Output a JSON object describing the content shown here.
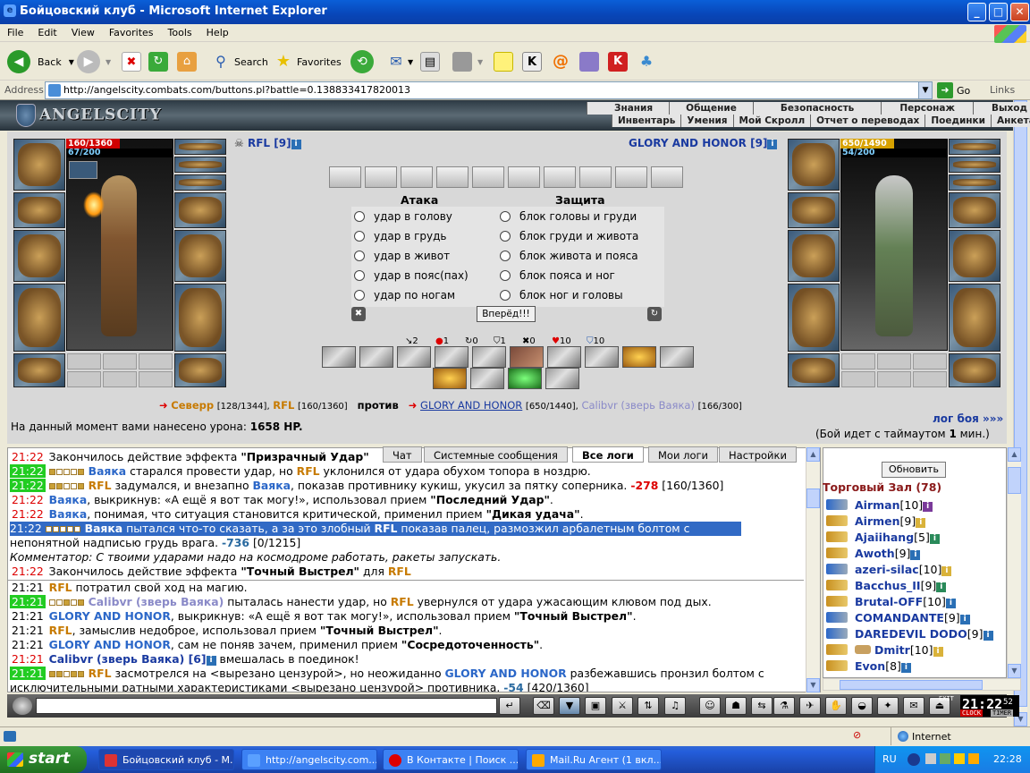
{
  "window": {
    "title": "Бойцовский клуб - Microsoft Internet Explorer",
    "min": "_",
    "max": "□",
    "close": "✕"
  },
  "menu": [
    "File",
    "Edit",
    "View",
    "Favorites",
    "Tools",
    "Help"
  ],
  "toolbar": {
    "back": "Back",
    "search": "Search",
    "favorites": "Favorites"
  },
  "address": {
    "label": "Address",
    "url": "http://angelscity.combats.com/buttons.pl?battle=0.138833417820013",
    "go": "Go",
    "links": "Links"
  },
  "game": {
    "logo": "ANGELSCITY",
    "nav_top": [
      "Знания",
      "Общение",
      "Безопасность",
      "Персонаж",
      "Выход"
    ],
    "nav_bottom": [
      "Инвентарь",
      "Умения",
      "Мой Скролл",
      "Отчет о переводах",
      "Поединки",
      "Анкета"
    ]
  },
  "battle": {
    "left": {
      "name": "RFL",
      "level": "[9]",
      "hp": "160/1360",
      "mp": "67/200",
      "hp_frac": 0.118,
      "mp_frac": 0.335
    },
    "right": {
      "name": "GLORY AND HONOR",
      "level": "[9]",
      "hp": "650/1490",
      "mp": "54/200",
      "hp_frac": 0.436,
      "mp_frac": 0.27
    },
    "attack_header": "Атака",
    "defense_header": "Защита",
    "attacks": [
      "удар в голову",
      "удар в грудь",
      "удар в живот",
      "удар в пояс(пах)",
      "удар по ногам"
    ],
    "defenses": [
      "блок головы и груди",
      "блок груди и живота",
      "блок живота и пояса",
      "блок пояса и ног",
      "блок ног и головы"
    ],
    "forward_button": "Вперёд!!!",
    "stats": [
      {
        "icon": "↘",
        "value": "2"
      },
      {
        "icon": "●",
        "value": "1"
      },
      {
        "icon": "↻",
        "value": "0"
      },
      {
        "icon": "⛉",
        "value": "1"
      },
      {
        "icon": "✖",
        "value": "0"
      },
      {
        "icon": "♥",
        "value": "10"
      },
      {
        "icon": "⛉",
        "value": "10"
      }
    ],
    "vs": {
      "left1": "Северр",
      "left1_hp": "[128/1344],",
      "left2": "RFL",
      "left2_hp": "[160/1360]",
      "vs_word": "против",
      "right1": "GLORY AND HONOR",
      "right1_hp": "[650/1440],",
      "right2": "Calibvr (зверь Ваяка)",
      "right2_hp": "[166/300]"
    },
    "damage_label": "На данный момент вами нанесено урона:",
    "damage_value": "1658 HP.",
    "log_link": "лог боя »»»",
    "timeout": {
      "prefix": "(Бой идет с таймаутом",
      "num": "1",
      "suffix": "мин.)"
    }
  },
  "chat_tabs": [
    "Чат",
    "Системные сообщения",
    "Все логи",
    "Мои логи",
    "Настройки"
  ],
  "log": [
    {
      "time": "21:22",
      "text": "Закончилось действие эффекта ",
      "bold": "\"Призрачный Удар\""
    },
    {
      "time": "21:22",
      "a": "Ваяка",
      "m1": " старался провести удар, но ",
      "b": "RFL",
      "m2": " уклонился от удара обухом топора в ноздрю."
    },
    {
      "time": "21:22",
      "a": "RFL",
      "m1": " задумался, и внезапно ",
      "b": "Ваяка",
      "m2": ", показав противнику кукиш, укусил за пятку соперника. ",
      "dmg": "-278",
      "hp": " [160/1360]"
    },
    {
      "time": "21:22",
      "a": "Ваяка",
      "m1": ", выкрикнув: «А ещё я вот так могу!», использовал прием ",
      "bold": "\"Последний Удар\"",
      "m2": "."
    },
    {
      "time": "21:22",
      "a": "Ваяка",
      "m1": ", понимая, что ситуация становится критической, применил прием ",
      "bold": "\"Дикая удача\"",
      "m2": "."
    },
    {
      "time": "21:22",
      "a": "Ваяка",
      "m1": " пытался что-то сказать, а за это злобный ",
      "b": "RFL",
      "m2": " показав палец, размозжил арбалетным болтом с"
    },
    {
      "cont": "непонятной надписью грудь врага. ",
      "dmg": "-736",
      "hp": " [0/1215]"
    },
    {
      "comment": "Комментатор: С твоими ударами надо на космодроме работать, ракеты запускать."
    },
    {
      "time": "21:22",
      "text": "Закончилось действие эффекта ",
      "bold": "\"Точный Выстрел\"",
      "m2": " для ",
      "b": "RFL"
    },
    {
      "time": "21:21",
      "a": "RFL",
      "m1": " потратил свой ход на магию."
    },
    {
      "time": "21:21",
      "a": "Calibvr (зверь Ваяка)",
      "m1": " пыталась нанести удар, но ",
      "b": "RFL",
      "m2": " увернулся от удара ужасающим клювом под дых."
    },
    {
      "time": "21:21",
      "a": "GLORY AND HONOR",
      "m1": ", выкрикнув: «А ещё я вот так могу!», использовал прием ",
      "bold": "\"Точный Выстрел\"",
      "m2": "."
    },
    {
      "time": "21:21",
      "a": "RFL",
      "m1": ", замыслив недоброе, использовал прием ",
      "bold": "\"Точный Выстрел\"",
      "m2": "."
    },
    {
      "time": "21:21",
      "a": "GLORY AND HONOR",
      "m1": ", сам не поняв зачем, применил прием ",
      "bold": "\"Сосредоточенность\"",
      "m2": "."
    },
    {
      "time": "21:21",
      "a": "Calibvr (зверь Ваяка) [6]",
      "m1": " вмешалась в поединок!"
    },
    {
      "time": "21:21",
      "a": "RFL",
      "m1": " засмотрелся на <вырезано цензурой>, но неожиданно ",
      "b": "GLORY AND HONOR",
      "m2": " разбежавшись пронзил болтом с"
    },
    {
      "cont": "исключительными ратными характеристиками <вырезано цензурой> противника. ",
      "dmg": "-54",
      "hp": " [420/1360]"
    }
  ],
  "room": {
    "refresh": "Обновить",
    "title": "Торговый Зал (78)",
    "users": [
      {
        "name": "Airman",
        "lvl": "[10]"
      },
      {
        "name": "Airmen",
        "lvl": "[9]"
      },
      {
        "name": "Ajaiihang",
        "lvl": "[5]"
      },
      {
        "name": "Awoth",
        "lvl": "[9]"
      },
      {
        "name": "azeri-silac",
        "lvl": "[10]"
      },
      {
        "name": "Bacchus_II",
        "lvl": "[9]"
      },
      {
        "name": "Brutal-OFF",
        "lvl": "[10]"
      },
      {
        "name": "COMANDANTE",
        "lvl": "[9]"
      },
      {
        "name": "DAREDEVIL DODO",
        "lvl": "[9]"
      },
      {
        "name": "Dmitr",
        "lvl": "[10]"
      },
      {
        "name": "Evon",
        "lvl": "[8]"
      }
    ]
  },
  "clock": {
    "time": "21:22",
    "sec": "52",
    "label_clock": "CLOCK",
    "label_timer": "TIMER",
    "exit": "EXIT"
  },
  "status": {
    "zone": "Internet"
  },
  "taskbar": {
    "start": "start",
    "tasks": [
      "Бойцовский клуб - М...",
      "http://angelscity.com...",
      "В Контакте | Поиск ...",
      "Mail.Ru Агент (1 вкл..."
    ],
    "lang": "RU",
    "time": "22:28"
  },
  "colors": {
    "accent": "#1a3aa0",
    "hp_red": "#d00000",
    "time_green": "#22cc22"
  }
}
